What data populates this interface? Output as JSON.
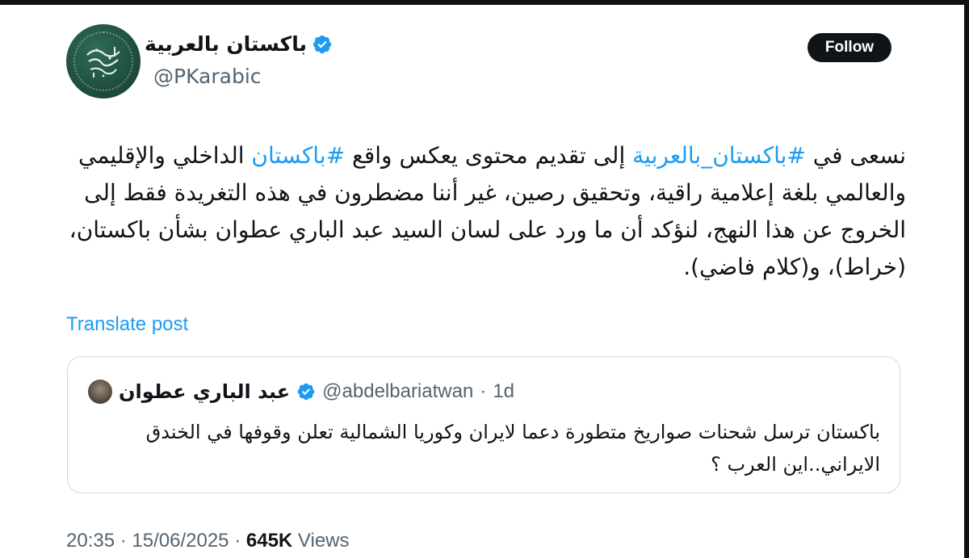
{
  "author": {
    "name": "باكستان بالعربية",
    "handle": "@PKarabic",
    "verified": true,
    "avatar_text": "باكستان بالعربية"
  },
  "follow_label": "Follow",
  "tweet": {
    "segments": [
      {
        "text": "نسعى في ",
        "tag": false
      },
      {
        "text": "#باكستان_بالعربية",
        "tag": true
      },
      {
        "text": " إلى تقديم محتوى يعكس واقع ",
        "tag": false
      },
      {
        "text": "#باكستان",
        "tag": true
      },
      {
        "text": " الداخلي والإقليمي والعالمي بلغة إعلامية راقية، وتحقيق رصين، غير أننا مضطرون في هذه التغريدة فقط إلى الخروج عن هذا النهج، لنؤكد أن ما ورد على لسان السيد عبد الباري عطوان بشأن باكستان، (خراط)، و(كلام فاضي).",
        "tag": false
      }
    ]
  },
  "translate_label": "Translate post",
  "quote": {
    "name": "عبد الباري عطوان",
    "handle": "@abdelbariatwan",
    "age": "1d",
    "verified": true,
    "text": "باكستان ترسل شحنات صواريخ متطورة دعما لايران وكوريا الشمالية تعلن وقوفها في الخندق الايراني..اين العرب ؟"
  },
  "meta": {
    "time": "20:35",
    "date": "15/06/2025",
    "views_count": "645K",
    "views_label": "Views"
  },
  "colors": {
    "link": "#1d9bf0",
    "verified": "#1d9bf0",
    "text": "#0f1419",
    "secondary": "#536471",
    "avatar_bg": "#1c4a3c"
  }
}
